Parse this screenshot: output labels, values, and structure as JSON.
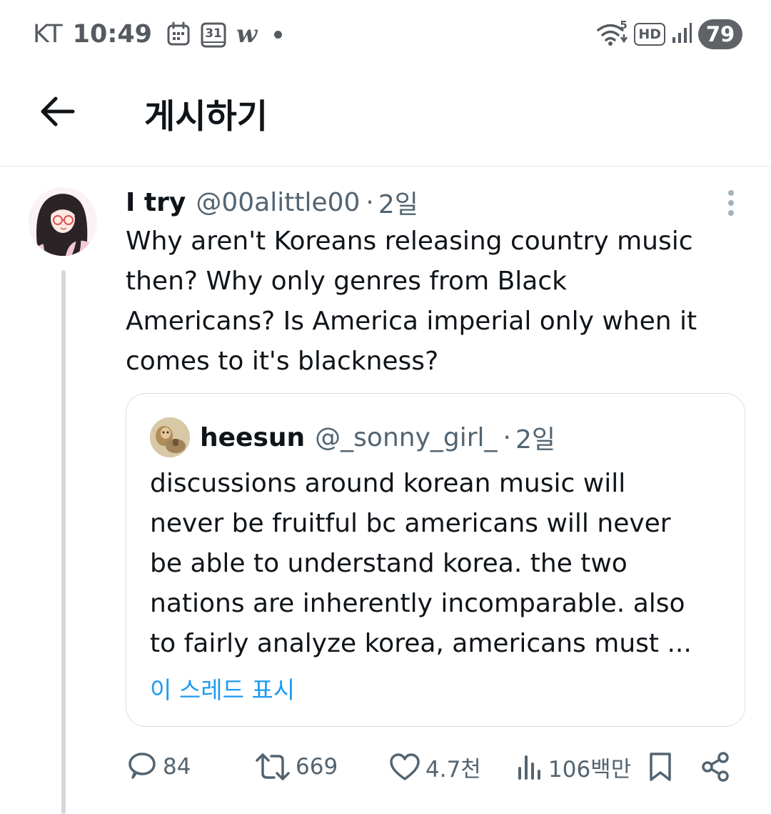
{
  "status_bar": {
    "carrier": "KT",
    "time": "10:49",
    "calendar_day": "31",
    "app_glyph": "w",
    "wifi_badge": "5",
    "hd_badge": "HD",
    "battery": "79"
  },
  "header": {
    "title": "게시하기"
  },
  "post": {
    "display_name": "I try",
    "handle": "@00alittle00",
    "separator": "·",
    "time": "2일",
    "text": "Why aren't Koreans releasing country music\nthen? Why only genres from Black\nAmericans? Is America imperial only when it\ncomes to it's blackness?"
  },
  "quote": {
    "display_name": "heesun",
    "handle": "@_sonny_girl_",
    "separator": "·",
    "time": "2일",
    "text": "discussions around korean music will\nnever be fruitful bc americans will never\nbe able to understand korea. the two\nnations are inherently incomparable. also\nto fairly analyze korea, americans must ...",
    "show_thread": "이 스레드 표시"
  },
  "actions": {
    "replies": "84",
    "reposts": "669",
    "likes": "4.7천",
    "views": "106백만"
  },
  "colors": {
    "text_primary": "#0f1419",
    "text_secondary": "#536471",
    "link": "#1d9bf0",
    "thread_line": "#cfd9de",
    "border": "#d9dee2"
  },
  "icons": {
    "back": "arrow-left-icon",
    "more": "more-vertical-icon",
    "reply": "reply-icon",
    "repost": "repost-icon",
    "like": "heart-icon",
    "views": "views-icon",
    "bookmark": "bookmark-icon",
    "share": "share-icon"
  }
}
